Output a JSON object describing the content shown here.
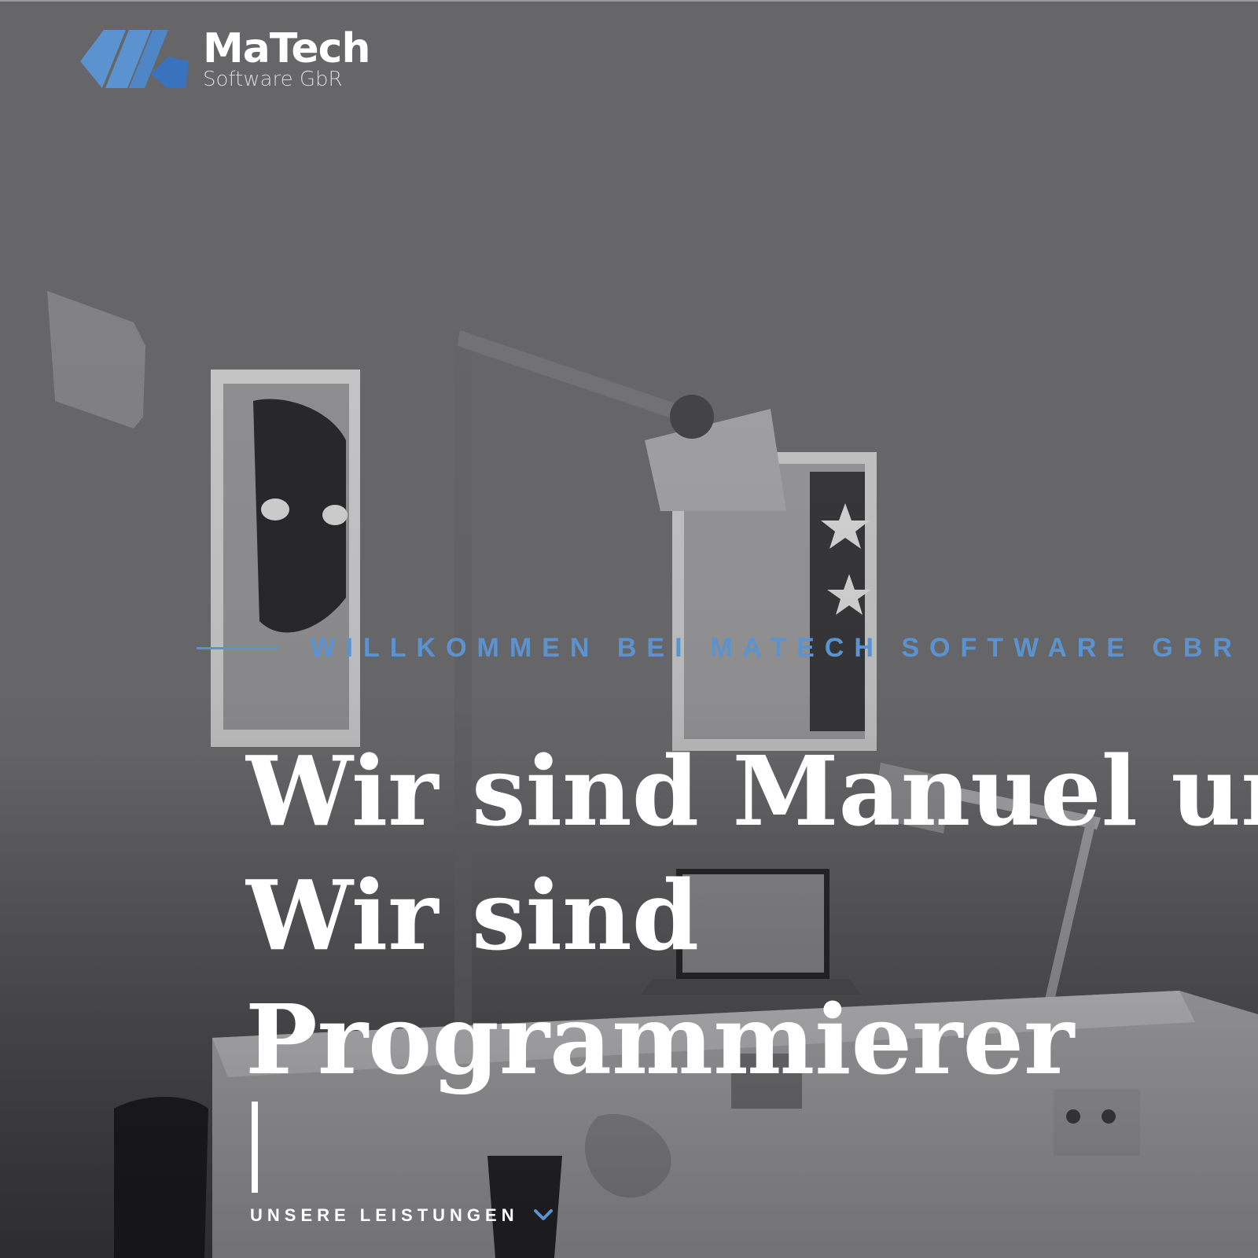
{
  "brand": {
    "name": "MaTech",
    "subtitle": "Software GbR",
    "accent_color": "#5b93d0",
    "logo_icon": "matech-logo-icon"
  },
  "hero": {
    "kicker": "WILLKOMMEN BEI MATECH SOFTWARE GBR",
    "headline_line1": "Wir sind Manuel und",
    "headline_line2": "Wir sind",
    "headline_line3": "Programmierer",
    "background": "grayscale photo of a creative office with desk lamps, framed comic posters and a laptop on a desk"
  },
  "cta": {
    "label": "UNSERE LEISTUNGEN",
    "icon": "chevron-down-icon"
  }
}
